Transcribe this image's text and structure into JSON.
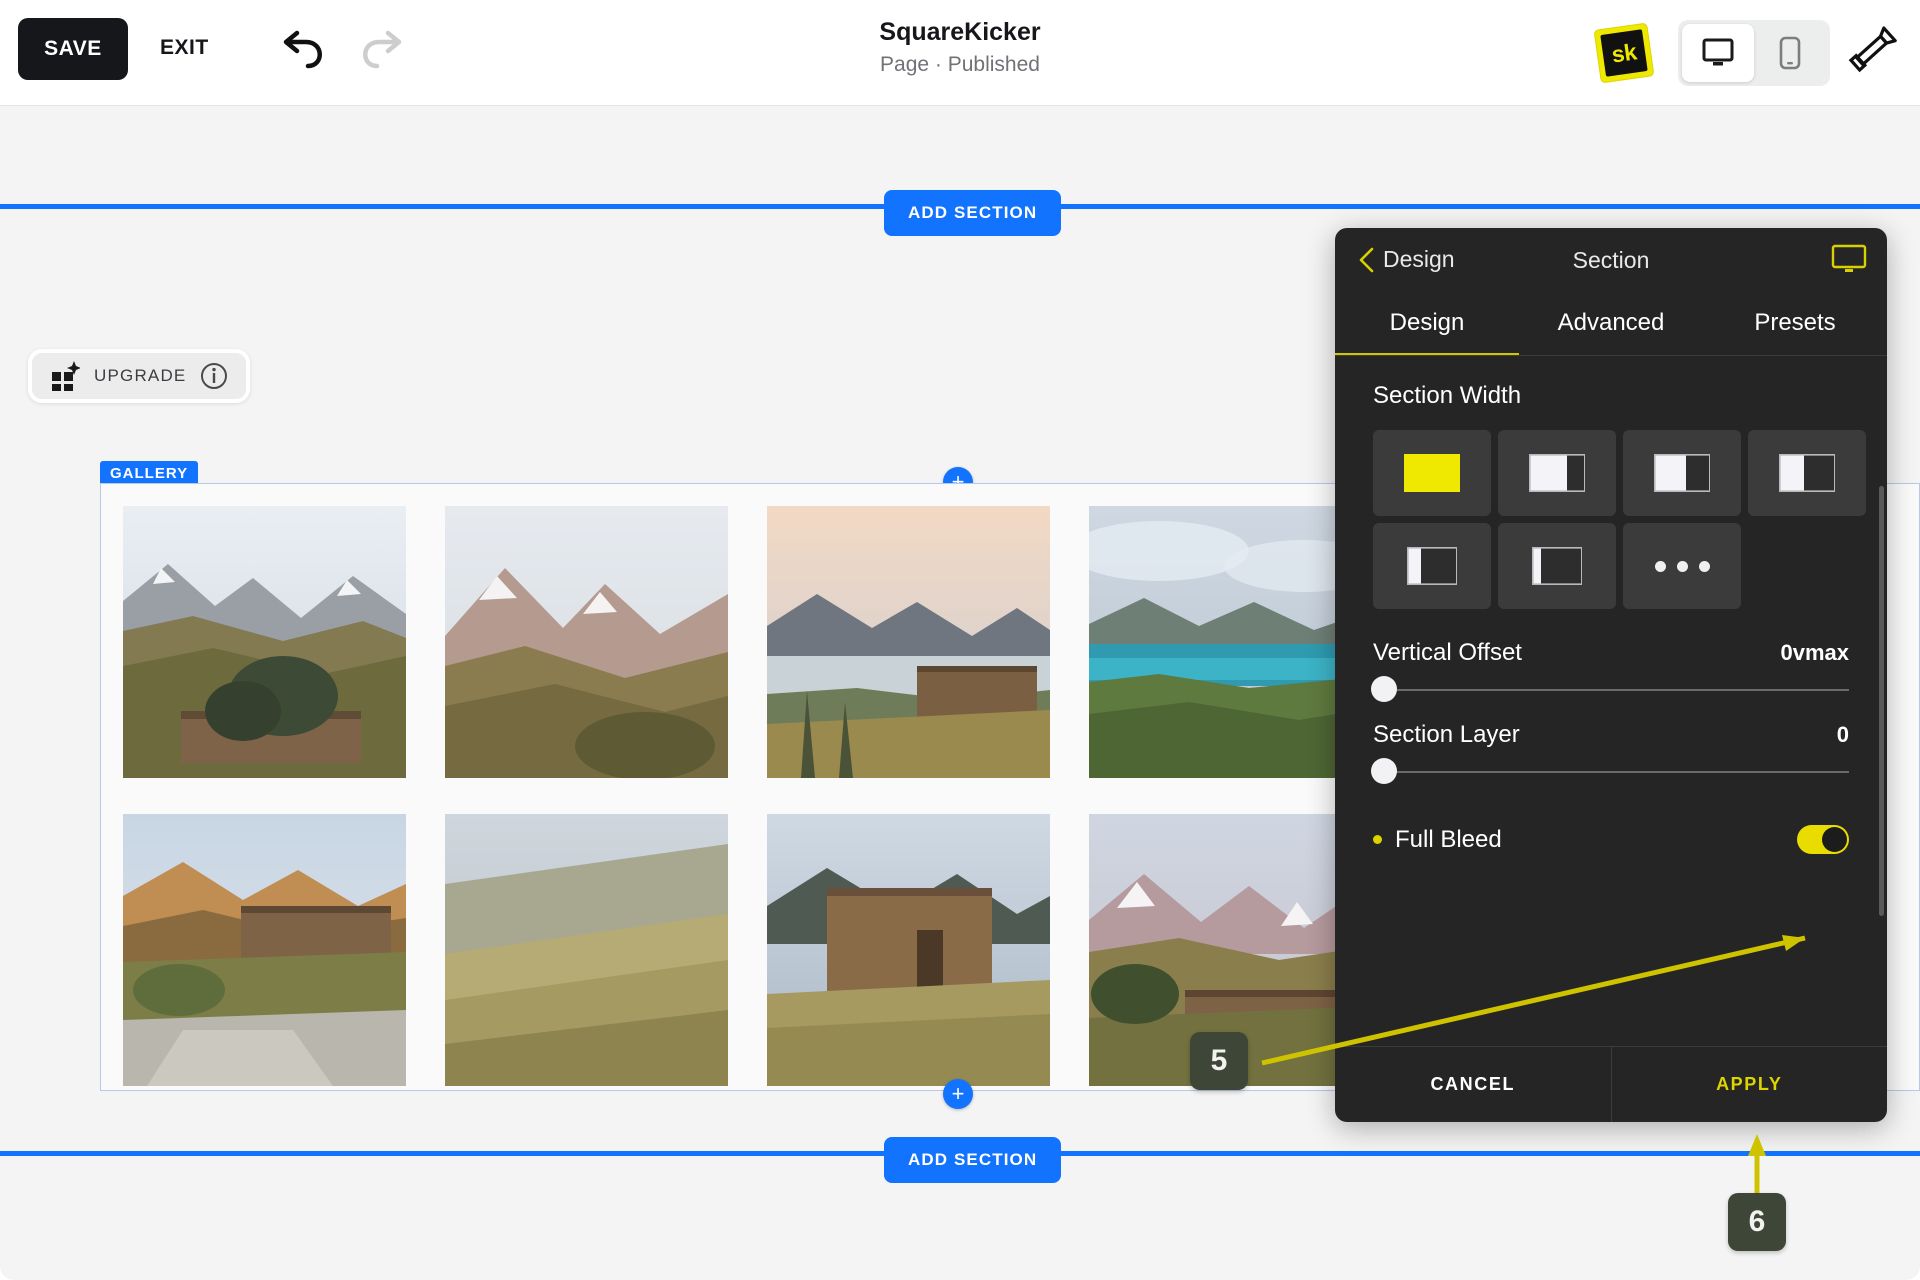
{
  "toolbar": {
    "save_label": "SAVE",
    "exit_label": "EXIT",
    "undo_icon": "undo-arrow-icon",
    "redo_icon": "redo-arrow-icon",
    "title": "SquareKicker",
    "subtitle": "Page · Published",
    "logo_text": "sk",
    "desktop_icon": "desktop-monitor-icon",
    "mobile_icon": "mobile-phone-icon",
    "brush_icon": "paintbrush-icon"
  },
  "canvas": {
    "add_section_top_label": "ADD SECTION",
    "add_section_bottom_label": "ADD SECTION",
    "upgrade_label": "UPGRADE",
    "upgrade_icon": "grid-sparkle-icon",
    "info_icon": "info-circle-icon",
    "gallery_tag": "GALLERY",
    "add_block_top_icon": "plus-circle-icon",
    "add_block_bottom_icon": "plus-circle-icon",
    "rule_color": "#1273ff",
    "gallery_outline_color": "#b9c8ea"
  },
  "panel": {
    "back_label": "Design",
    "back_icon": "chevron-left-icon",
    "title": "Section",
    "monitor_icon": "desktop-monitor-icon",
    "accent_color": "#dcd400",
    "background_color": "#252525",
    "tabs": [
      {
        "label": "Design",
        "active": true
      },
      {
        "label": "Advanced",
        "active": false
      },
      {
        "label": "Presets",
        "active": false
      }
    ],
    "section_width": {
      "label": "Section Width",
      "options": [
        {
          "name": "full-width",
          "selected": true,
          "fill": 0
        },
        {
          "name": "width-option-2",
          "selected": false,
          "fill": 0.3
        },
        {
          "name": "width-option-3",
          "selected": false,
          "fill": 0.42
        },
        {
          "name": "width-option-4",
          "selected": false,
          "fill": 0.55
        },
        {
          "name": "width-option-5",
          "selected": false,
          "fill": 0.7
        },
        {
          "name": "width-option-6",
          "selected": false,
          "fill": 0.8
        },
        {
          "name": "more-options",
          "selected": false,
          "more": true
        }
      ]
    },
    "sliders": [
      {
        "name": "Vertical Offset",
        "value": "0vmax",
        "position": 0
      },
      {
        "name": "Section Layer",
        "value": "0",
        "position": 0
      }
    ],
    "full_bleed": {
      "label": "Full Bleed",
      "enabled": true
    },
    "cancel_label": "CANCEL",
    "apply_label": "APPLY"
  },
  "callouts": [
    {
      "number": "5",
      "target": "full-bleed-toggle"
    },
    {
      "number": "6",
      "target": "apply-button"
    }
  ]
}
